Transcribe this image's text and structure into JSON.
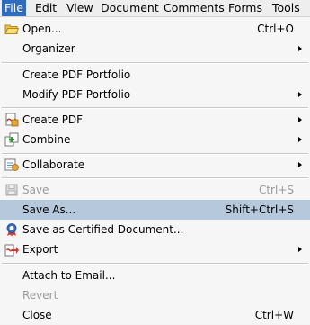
{
  "menubar": {
    "items": [
      "File",
      "Edit",
      "View",
      "Document",
      "Comments",
      "Forms",
      "Tools"
    ]
  },
  "menu": {
    "open": {
      "label": "Open...",
      "shortcut": "Ctrl+O"
    },
    "organizer": {
      "label": "Organizer"
    },
    "create_portfolio": {
      "label": "Create PDF Portfolio"
    },
    "modify_portfolio": {
      "label": "Modify PDF Portfolio"
    },
    "create_pdf": {
      "label": "Create PDF"
    },
    "combine": {
      "label": "Combine"
    },
    "collaborate": {
      "label": "Collaborate"
    },
    "save": {
      "label": "Save",
      "shortcut": "Ctrl+S"
    },
    "save_as": {
      "label": "Save As...",
      "shortcut": "Shift+Ctrl+S"
    },
    "save_certified": {
      "label": "Save as Certified Document..."
    },
    "export": {
      "label": "Export"
    },
    "attach_email": {
      "label": "Attach to Email..."
    },
    "revert": {
      "label": "Revert"
    },
    "close": {
      "label": "Close",
      "shortcut": "Ctrl+W"
    }
  },
  "colors": {
    "menubar_active": "#2f6cc0",
    "row_highlight": "#b6c9dc",
    "disabled_text": "#999999"
  }
}
